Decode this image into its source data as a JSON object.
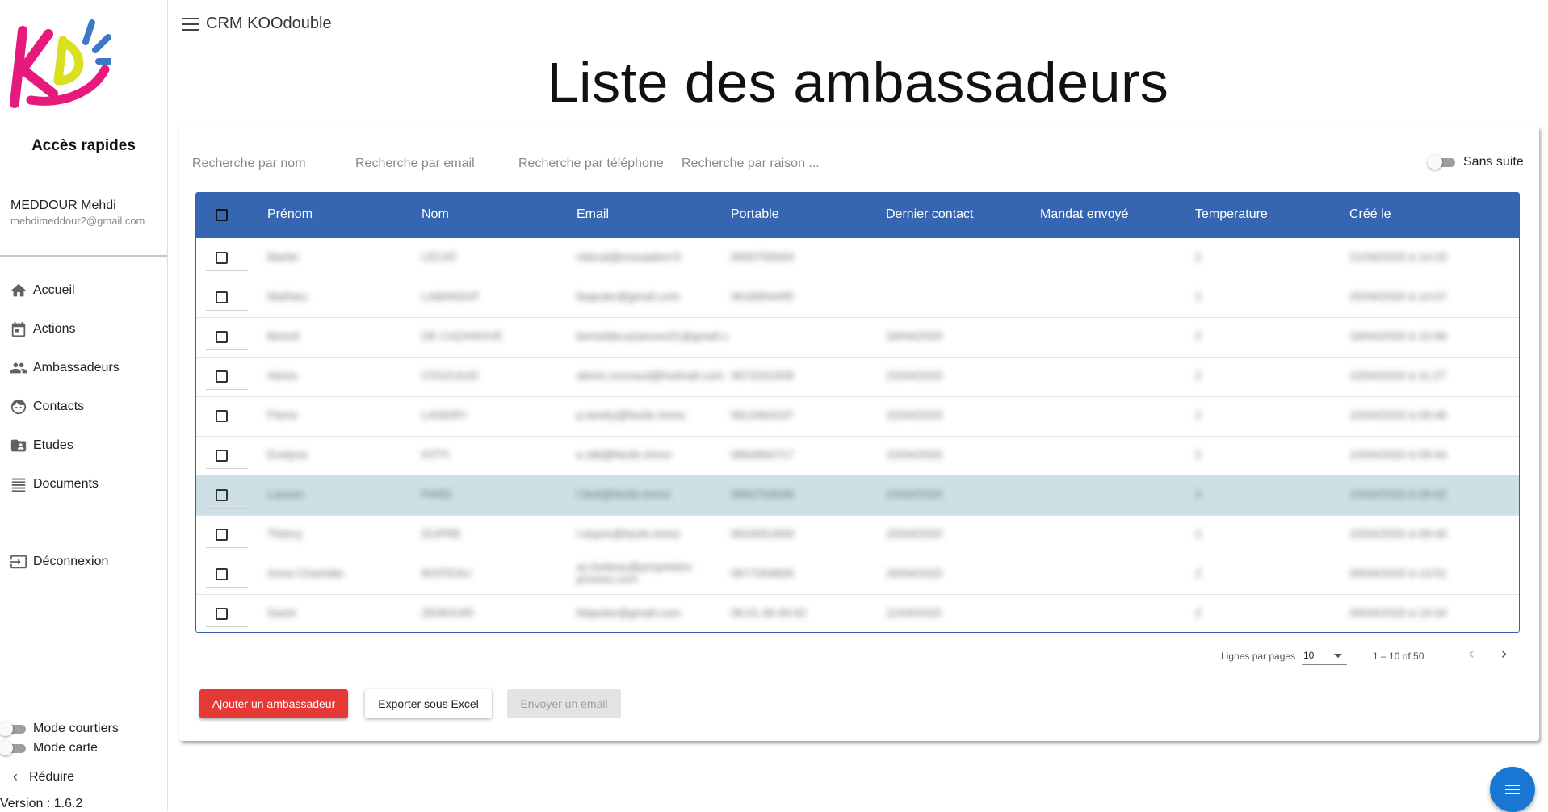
{
  "app": {
    "title": "CRM KOOdouble",
    "version": "Version : 1.6.2"
  },
  "sidebar": {
    "quick_access": "Accès rapides",
    "user_name": "MEDDOUR Mehdi",
    "user_email": "mehdimeddour2@gmail.com",
    "items": [
      {
        "label": "Accueil",
        "icon": "home-icon"
      },
      {
        "label": "Actions",
        "icon": "calendar-icon"
      },
      {
        "label": "Ambassadeurs",
        "icon": "people-icon"
      },
      {
        "label": "Contacts",
        "icon": "face-icon"
      },
      {
        "label": "Etudes",
        "icon": "folder-shared-icon"
      },
      {
        "label": "Documents",
        "icon": "list-icon"
      }
    ],
    "logout": "Déconnexion",
    "mode_courtiers": "Mode courtiers",
    "mode_courtiers_on": false,
    "mode_carte": "Mode carte",
    "mode_carte_on": false,
    "collapse": "Réduire"
  },
  "page": {
    "title": "Liste des ambassadeurs"
  },
  "search": {
    "name_placeholder": "Recherche par nom",
    "email_placeholder": "Recherche par email",
    "phone_placeholder": "Recherche par téléphone",
    "company_placeholder": "Recherche par raison ..."
  },
  "filter": {
    "sans_suite": "Sans suite",
    "sans_suite_on": false
  },
  "table": {
    "columns": [
      "Prénom",
      "Nom",
      "Email",
      "Portable",
      "Dernier contact",
      "Mandat envoyé",
      "Temperature",
      "Créé le"
    ],
    "selected_row": 6,
    "rows": [
      [
        "Martin",
        "LECAT",
        "mlecat@mouadent.fr",
        "0650758344",
        "",
        "",
        "2",
        "21/04/2020 à 14:19"
      ],
      [
        "Mathieu",
        "LABANSAT",
        "lbapuler@gmail.com",
        "0618954495",
        "",
        "",
        "2",
        "20/04/2020 à 14:07"
      ],
      [
        "Benoit",
        "DE CAZANOVE",
        "benoitdecazanove31@gmail.c",
        "",
        "16/04/2020",
        "",
        "2",
        "16/04/2020 à 10:56"
      ],
      [
        "Alexis",
        "COUCAUD",
        "alexis.coucaud@hotmail.com",
        "0673161508",
        "15/04/2020",
        "",
        "2",
        "10/04/2020 à 11:27"
      ],
      [
        "Pierre",
        "LANDRY",
        "p.landry@facile.immo",
        "0613464107",
        "15/04/2020",
        "",
        "2",
        "10/04/2020 à 09:46"
      ],
      [
        "Evelyne",
        "KITTI",
        "e.sitti@facile.immo",
        "0664964717",
        "15/04/2020",
        "",
        "2",
        "10/04/2020 à 09:44"
      ],
      [
        "Lassen",
        "PARD",
        "l.fard@facile.immo",
        "0660754546",
        "10/04/2020",
        "",
        "2",
        "10/04/2020 à 09:42"
      ],
      [
        "Thierry",
        "DUPRE",
        "t.dupre@facile.immo",
        "0624051609",
        "15/04/2020",
        "",
        "2",
        "10/04/2020 à 09:40"
      ],
      [
        "Anne-Charlotte",
        "BOITEAU",
        "ac.boiteau@proprietes-privees.com",
        "0677264826",
        "16/04/2020",
        "",
        "2",
        "09/04/2020 à 14:51"
      ],
      [
        "Samir",
        "ZEMOURI",
        "fdapuler@gmail.com",
        "06.01.48.49.62",
        "11/04/2020",
        "",
        "2",
        "09/04/2020 à 10:34"
      ]
    ]
  },
  "pagination": {
    "rows_label": "Lignes par pages",
    "rows_value": "10",
    "range": "1 – 10 of 50"
  },
  "actions": {
    "add": "Ajouter un ambassadeur",
    "export": "Exporter sous Excel",
    "email": "Envoyer un email"
  },
  "colors": {
    "primary": "#3665b1",
    "danger": "#e53935",
    "fab": "#1976d2",
    "selected_row": "#cde0e5"
  }
}
